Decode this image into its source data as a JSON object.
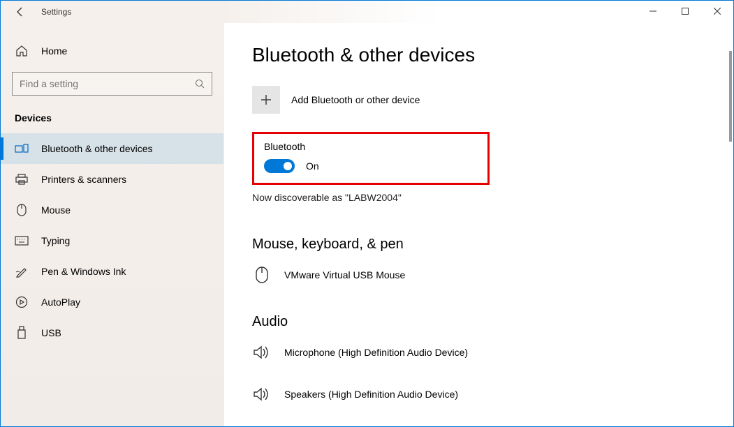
{
  "titlebar": {
    "app_name": "Settings"
  },
  "sidebar": {
    "home_label": "Home",
    "search_placeholder": "Find a setting",
    "section_header": "Devices",
    "items": [
      {
        "label": "Bluetooth & other devices"
      },
      {
        "label": "Printers & scanners"
      },
      {
        "label": "Mouse"
      },
      {
        "label": "Typing"
      },
      {
        "label": "Pen & Windows Ink"
      },
      {
        "label": "AutoPlay"
      },
      {
        "label": "USB"
      }
    ]
  },
  "main": {
    "page_title": "Bluetooth & other devices",
    "add_device_label": "Add Bluetooth or other device",
    "bluetooth_section_label": "Bluetooth",
    "bluetooth_toggle_state": "On",
    "discoverable_text": "Now discoverable as \"LABW2004\"",
    "mouse_section_header": "Mouse, keyboard, & pen",
    "mouse_device_name": "VMware Virtual USB Mouse",
    "audio_section_header": "Audio",
    "audio_device_1": "Microphone (High Definition Audio Device)",
    "audio_device_2": "Speakers (High Definition Audio Device)"
  }
}
